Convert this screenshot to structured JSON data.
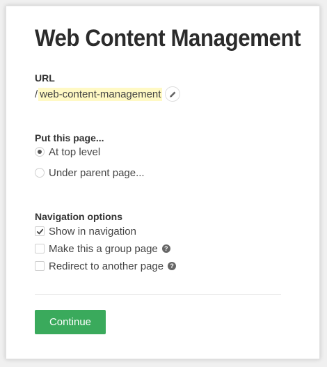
{
  "page": {
    "title": "Web Content Management"
  },
  "url_section": {
    "label": "URL",
    "prefix": "/",
    "slug": "web-content-management",
    "edit_icon": "pencil-icon"
  },
  "placement_section": {
    "label": "Put this page...",
    "options": [
      {
        "label": "At top level",
        "selected": true
      },
      {
        "label": "Under parent page...",
        "selected": false
      }
    ]
  },
  "navigation_section": {
    "label": "Navigation options",
    "options": [
      {
        "label": "Show in navigation",
        "checked": true,
        "help": false
      },
      {
        "label": "Make this a group page",
        "checked": false,
        "help": true
      },
      {
        "label": "Redirect to another page",
        "checked": false,
        "help": true
      }
    ],
    "help_icon": "question-icon"
  },
  "actions": {
    "continue_label": "Continue"
  },
  "colors": {
    "accent_green": "#3aaa5c",
    "slug_highlight": "#fff9c4"
  }
}
